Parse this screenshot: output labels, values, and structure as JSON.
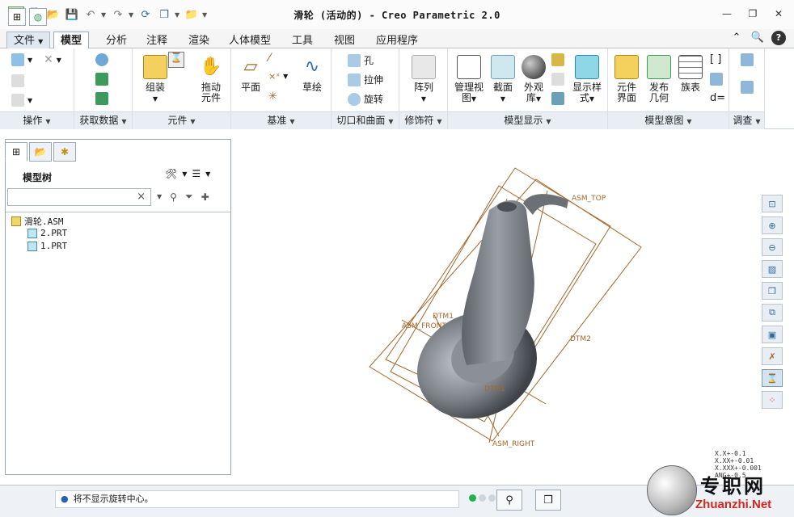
{
  "window": {
    "title": "滑轮 (活动的) - Creo Parametric 2.0"
  },
  "ribbon_tabs": [
    "文件",
    "模型",
    "分析",
    "注释",
    "渲染",
    "人体模型",
    "工具",
    "视图",
    "应用程序"
  ],
  "ribbon": {
    "groups": {
      "operations": "操作",
      "get_data": "获取数据",
      "components": "元件",
      "datum": "基准",
      "cut_surface": "切口和曲面",
      "modifiers": "修饰符",
      "model_display": "模型显示",
      "model_intent": "模型意图",
      "investigate": "调查"
    },
    "commands": {
      "assemble": "组装",
      "drag_1": "拖动",
      "drag_2": "元件",
      "plane": "平面",
      "sketch": "草绘",
      "hole": "孔",
      "extrude": "拉伸",
      "revolve": "旋转",
      "pattern": "阵列",
      "manage_views_1": "管理视",
      "manage_views_2": "图",
      "section": "截面",
      "appearance_1": "外观",
      "appearance_2": "库",
      "display_style_1": "显示样",
      "display_style_2": "式",
      "comp_interface_1": "元件",
      "comp_interface_2": "界面",
      "publish_geom_1": "发布",
      "publish_geom_2": "几何",
      "family_table": "族表",
      "d_equals": "d="
    }
  },
  "model_tree": {
    "title": "模型树",
    "search_clear": "×",
    "nodes": [
      "滑轮.ASM",
      "2.PRT",
      "1.PRT"
    ]
  },
  "viewport": {
    "datum_labels": [
      "ASM_TOP",
      "DTM1",
      "ASM_FRONT",
      "DTM2",
      "DTM1",
      "ASM_RIGHT"
    ],
    "tolerance": [
      "X.X+-0.1",
      "X.XX+-0.01",
      "X.XXX+-0.001",
      "ANG+-0.5"
    ]
  },
  "status": {
    "message": "将不显示旋转中心。"
  },
  "watermark": {
    "cn": "专职网",
    "en": "Zhuanzhi.Net"
  },
  "colors": {
    "ribbon_footer": "#e9eef4",
    "datum": "#a4682c",
    "model_gray": "#7e8389"
  }
}
